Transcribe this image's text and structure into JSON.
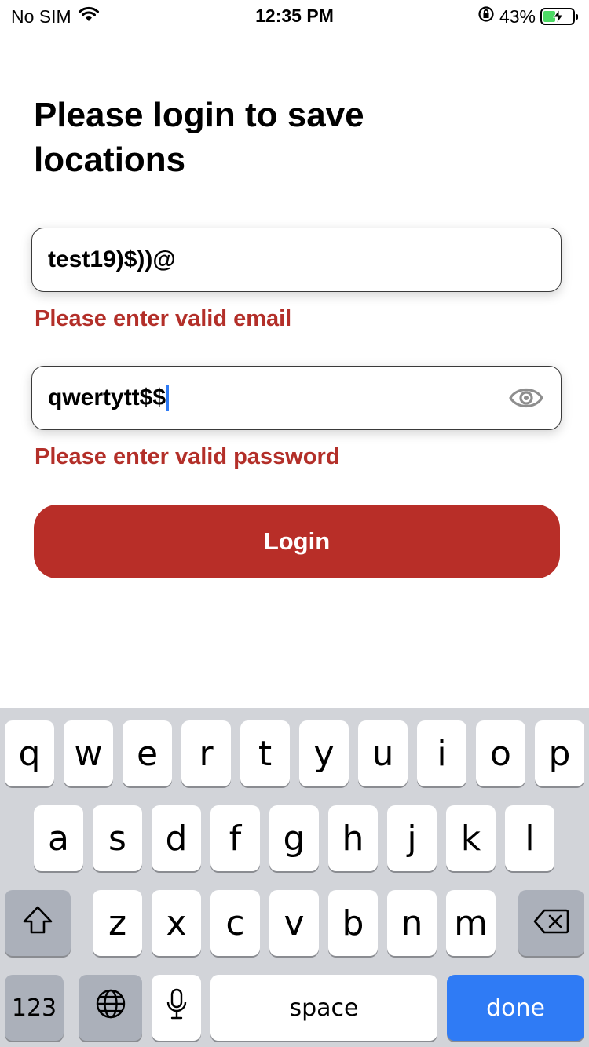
{
  "status_bar": {
    "carrier": "No SIM",
    "time": "12:35 PM",
    "battery_percent": "43%",
    "battery_level": 0.43,
    "icons": [
      "wifi-icon",
      "rotation-lock-icon",
      "battery-charging-icon"
    ]
  },
  "page": {
    "title": "Please login to save locations"
  },
  "form": {
    "email_value": "test19)$))@",
    "email_error": "Please enter valid email",
    "password_value": "qwertytt$$",
    "password_error": "Please enter valid password",
    "login_label": "Login"
  },
  "colors": {
    "accent": "#b82e28",
    "error": "#b32f29",
    "caret": "#2f7bf5",
    "keyboard_bg": "#d2d4d9",
    "done_key": "#2f7bf5"
  },
  "keyboard": {
    "row1": [
      "q",
      "w",
      "e",
      "r",
      "t",
      "y",
      "u",
      "i",
      "o",
      "p"
    ],
    "row2": [
      "a",
      "s",
      "d",
      "f",
      "g",
      "h",
      "j",
      "k",
      "l"
    ],
    "row3": [
      "z",
      "x",
      "c",
      "v",
      "b",
      "n",
      "m"
    ],
    "numbers_label": "123",
    "space_label": "space",
    "done_label": "done",
    "icons": [
      "shift-icon",
      "backspace-icon",
      "globe-icon",
      "microphone-icon"
    ]
  }
}
